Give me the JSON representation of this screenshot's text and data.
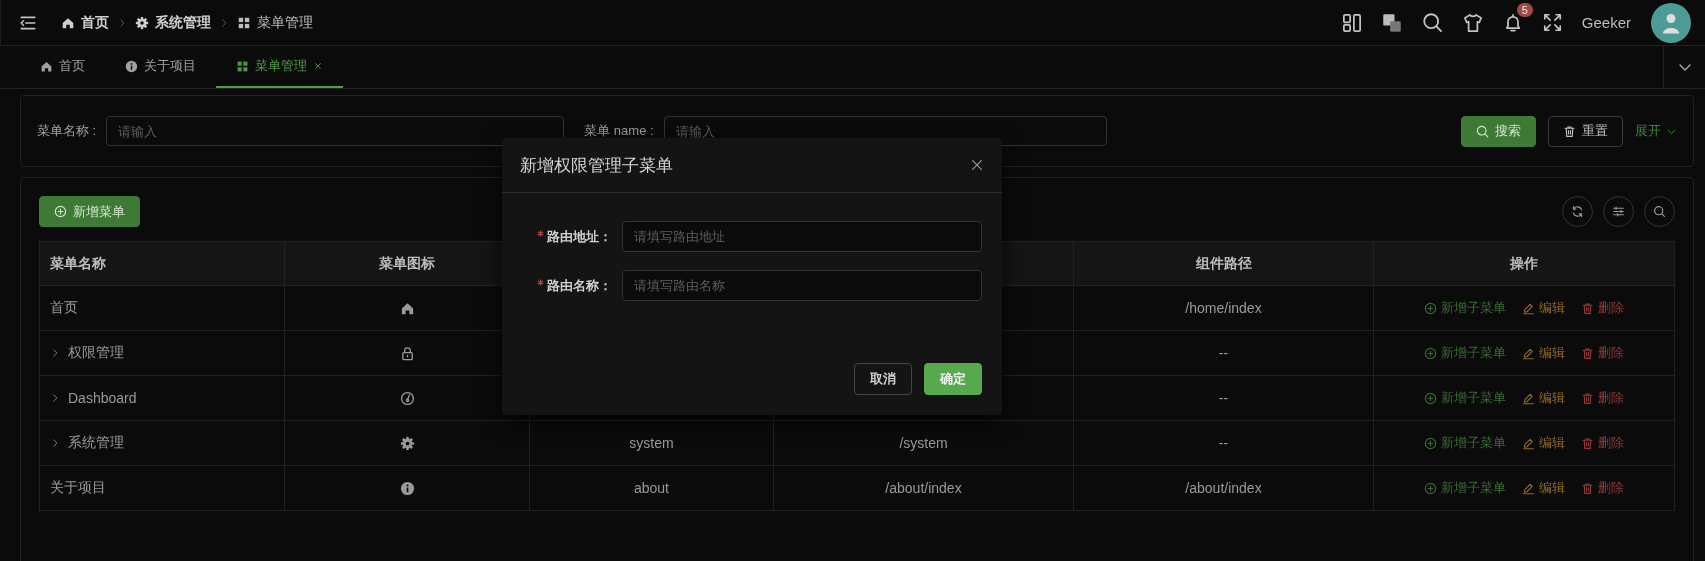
{
  "header": {
    "breadcrumb": [
      {
        "label": "首页",
        "kind": "home"
      },
      {
        "label": "系统管理",
        "kind": "gear"
      },
      {
        "label": "菜单管理",
        "kind": "grid"
      }
    ],
    "notification_count": "5",
    "username": "Geeker"
  },
  "tabs": [
    {
      "label": "首页",
      "kind": "home",
      "selected": false,
      "closable": false
    },
    {
      "label": "关于项目",
      "kind": "info",
      "selected": false,
      "closable": false
    },
    {
      "label": "菜单管理",
      "kind": "grid",
      "selected": true,
      "closable": true
    }
  ],
  "search_form": {
    "fields": [
      {
        "label": "菜单名称 :",
        "placeholder": "请输入"
      },
      {
        "label": "菜单 name :",
        "placeholder": "请输入"
      }
    ],
    "buttons": [
      {
        "label": "搜索",
        "kind": "primary"
      },
      {
        "label": "重置",
        "kind": "reset"
      }
    ],
    "expand_link": "展开"
  },
  "toolbar": {
    "add_button": "新增菜单"
  },
  "table": {
    "header": {
      "column_1": "菜单名称",
      "column_2": "菜单图标",
      "column_5": "组件路径",
      "column_6": "操作"
    },
    "rows": [
      {
        "name": "首页",
        "expandable": false,
        "kind": "home",
        "column_5": "/home/index",
        "actions": [
          {
            "label": "新增子菜单",
            "kind": "add"
          },
          {
            "label": "编辑",
            "kind": "edit"
          },
          {
            "label": "删除",
            "kind": "delete"
          }
        ]
      },
      {
        "name": "权限管理",
        "expandable": true,
        "kind": "lock",
        "column_5": "--",
        "actions": [
          {
            "label": "新增子菜单",
            "kind": "add"
          },
          {
            "label": "编辑",
            "kind": "edit"
          },
          {
            "label": "删除",
            "kind": "delete"
          }
        ]
      },
      {
        "name": "Dashboard",
        "expandable": true,
        "kind": "dashboard",
        "column_5": "--",
        "actions": [
          {
            "label": "新增子菜单",
            "kind": "add"
          },
          {
            "label": "编辑",
            "kind": "edit"
          },
          {
            "label": "删除",
            "kind": "delete"
          }
        ]
      },
      {
        "name": "系统管理",
        "expandable": true,
        "kind": "gear",
        "column_3": "system",
        "column_4": "/system",
        "column_5": "--",
        "actions": [
          {
            "label": "新增子菜单",
            "kind": "add"
          },
          {
            "label": "编辑",
            "kind": "edit"
          },
          {
            "label": "删除",
            "kind": "delete"
          }
        ]
      },
      {
        "name": "关于项目",
        "expandable": false,
        "kind": "info",
        "column_3": "about",
        "column_4": "/about/index",
        "column_5": "/about/index",
        "actions": [
          {
            "label": "新增子菜单",
            "kind": "add"
          },
          {
            "label": "编辑",
            "kind": "edit"
          },
          {
            "label": "删除",
            "kind": "delete"
          }
        ]
      }
    ]
  },
  "dialog": {
    "title": "新增权限管理子菜单",
    "fields": [
      {
        "label": "路由地址：",
        "placeholder": "请填写路由地址",
        "required": true
      },
      {
        "label": "路由名称：",
        "placeholder": "请填写路由名称",
        "required": true
      }
    ],
    "buttons": [
      {
        "label": "取消",
        "kind": "default"
      },
      {
        "label": "确定",
        "kind": "primary"
      }
    ]
  }
}
